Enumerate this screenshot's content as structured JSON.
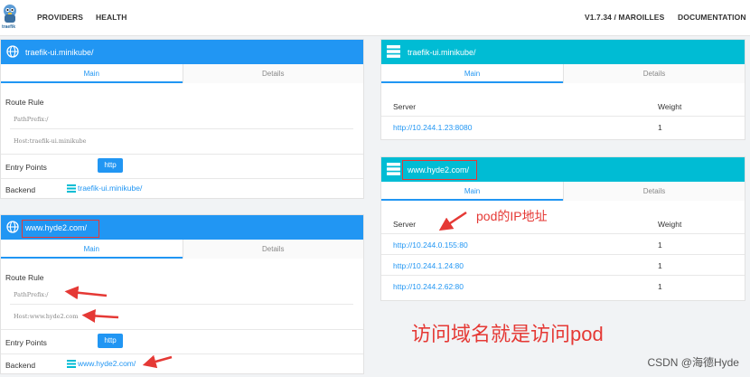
{
  "navbar": {
    "logo_text": "traefik",
    "links": [
      "PROVIDERS",
      "HEALTH"
    ],
    "version": "V1.7.34 / MAROILLES",
    "docs": "DOCUMENTATION"
  },
  "frontends": [
    {
      "title": "traefik-ui.minikube/",
      "tabs": [
        "Main",
        "Details"
      ],
      "route_rule_label": "Route Rule",
      "rules": [
        "PathPrefix:/",
        "Host:traefik-ui.minikube"
      ],
      "entry_points_label": "Entry Points",
      "entry_point": "http",
      "backend_label": "Backend",
      "backend": "traefik-ui.minikube/"
    },
    {
      "title": "www.hyde2.com/",
      "tabs": [
        "Main",
        "Details"
      ],
      "route_rule_label": "Route Rule",
      "rules": [
        "PathPrefix:/",
        "Host:www.hyde2.com"
      ],
      "entry_points_label": "Entry Points",
      "entry_point": "http",
      "backend_label": "Backend",
      "backend": "www.hyde2.com/"
    }
  ],
  "backends": [
    {
      "title": "traefik-ui.minikube/",
      "tabs": [
        "Main",
        "Details"
      ],
      "server_header": "Server",
      "weight_header": "Weight",
      "servers": [
        {
          "url": "http://10.244.1.23:8080",
          "weight": "1"
        }
      ]
    },
    {
      "title": "www.hyde2.com/",
      "tabs": [
        "Main",
        "Details"
      ],
      "server_header": "Server",
      "weight_header": "Weight",
      "servers": [
        {
          "url": "http://10.244.0.155:80",
          "weight": "1"
        },
        {
          "url": "http://10.244.1.24:80",
          "weight": "1"
        },
        {
          "url": "http://10.244.2.62:80",
          "weight": "1"
        }
      ]
    }
  ],
  "annotations": {
    "pod_ip": "pod的IP地址",
    "domain_note": "访问域名就是访问pod",
    "watermark": "CSDN @海德Hyde"
  },
  "colors": {
    "blue": "#2196f3",
    "cyan": "#00bcd4",
    "annotation_red": "#e53935"
  }
}
